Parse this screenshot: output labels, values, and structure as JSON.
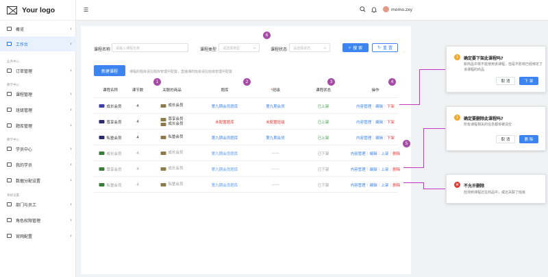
{
  "app": {
    "logo_text": "Your logo",
    "user_name": "momo.zxy"
  },
  "sidebar": {
    "items": [
      {
        "label": "概览"
      },
      {
        "label": "工作台"
      },
      {
        "label": "订单管理"
      },
      {
        "label": "课程管理"
      },
      {
        "label": "班级管理"
      },
      {
        "label": "题库管理"
      },
      {
        "label": "学员中心"
      },
      {
        "label": "我的学员"
      },
      {
        "label": "数据分配设置"
      },
      {
        "label": "部门与员工"
      },
      {
        "label": "角色权限管理"
      },
      {
        "label": "官网配置"
      }
    ],
    "groups": [
      "业务中心",
      "教学中心",
      "教学中心",
      "系统设置"
    ]
  },
  "filters": {
    "name_label": "课程名称",
    "name_placeholder": "请输入课程名称",
    "type_label": "课程类型",
    "type_placeholder": "请选择类型",
    "status_label": "课程状态",
    "status_placeholder": "请选择状态",
    "search_button": "搜 索",
    "reset_button": "重 置"
  },
  "toolbar": {
    "new_button": "新建课程",
    "hint": "课程的题库请在题库管理中配置，直播课的班级请在班级管理中配置"
  },
  "table": {
    "headers": [
      "课程名称",
      "课节数",
      "关联的商品",
      "题库",
      "班级",
      "课程状态",
      "操作"
    ],
    "class_required_mark": "*",
    "rows": [
      {
        "badge_color": "#3f3fb0",
        "name": "成长会员",
        "lessons": "4",
        "goods": [
          "成长会员"
        ],
        "goods_badge": "#8c7b4b",
        "bank": "第九期会员题库",
        "cls": "第九期会员",
        "status": "已上架",
        "ops": [
          "内容管理",
          "编辑",
          "下架"
        ],
        "dim": false,
        "bank_red": false
      },
      {
        "badge_color": "#2a2a6e",
        "name": "尊享会员",
        "lessons": "4",
        "goods": [
          "尊享会员",
          "成长会员"
        ],
        "goods_badge": "#8c7b4b",
        "bank": "未配置题库",
        "cls": "未配置班级",
        "status": "已上架",
        "ops": [
          "内容管理",
          "编辑",
          "下架"
        ],
        "dim": false,
        "bank_red": true
      },
      {
        "badge_color": "#2a2a6e",
        "name": "私塾会员",
        "lessons": "4",
        "goods": [
          "私塾会员"
        ],
        "goods_badge": "#8c7b4b",
        "bank": "第九期会员题库",
        "cls": "第九期会员",
        "status": "已上架",
        "ops": [
          "内容管理",
          "编辑",
          "下架"
        ],
        "dim": false,
        "bank_red": false
      },
      {
        "badge_color": "#3a7d3a",
        "name": "成长会员",
        "lessons": "4",
        "goods": [
          "成长会员"
        ],
        "goods_badge": "#8c7b4b",
        "bank": "第九期会员题库",
        "cls": "——",
        "status": "已下架",
        "ops": [
          "内容管理",
          "编辑",
          "上架",
          "删除"
        ],
        "dim": true,
        "bank_red": false
      },
      {
        "badge_color": "#3a7d3a",
        "name": "尊享会员",
        "lessons": "4",
        "goods": [
          "成长会员"
        ],
        "goods_badge": "#8c7b4b",
        "bank": "第九期会员题库",
        "cls": "——",
        "status": "已下架",
        "ops": [
          "内容管理",
          "编辑",
          "上架",
          "删除"
        ],
        "dim": true,
        "bank_red": false
      },
      {
        "badge_color": "#3a7d3a",
        "name": "私塾会员",
        "lessons": "4",
        "goods": [
          "私塾会员"
        ],
        "goods_badge": "#8c7b4b",
        "bank": "第九期会员题库",
        "cls": "——",
        "status": "已下架",
        "ops": [
          "内容管理",
          "编辑",
          "上架",
          "删除"
        ],
        "dim": true,
        "bank_red": false
      }
    ]
  },
  "markers": [
    "1",
    "2",
    "3",
    "4",
    "5",
    "6"
  ],
  "dialogs": {
    "offline": {
      "title": "确定要下架此课程吗?",
      "body": "新商品中将不能使用该课程，但是不影响已经绑定了该课程的商品",
      "cancel": "取 消",
      "ok": "下 架"
    },
    "delete": {
      "title": "确定要删除此课程吗?",
      "body": "所有课程相关的信息都将被清空",
      "cancel": "取 消",
      "ok": "删 除"
    },
    "forbidden": {
      "title": "不允许删除",
      "body": "检测到课程还在商品中，或还关联了班级"
    }
  },
  "colors": {
    "primary": "#3c85f0",
    "danger": "#e53935",
    "success": "#43a047",
    "warning": "#f5a623",
    "annotation": "#a64ca6"
  }
}
